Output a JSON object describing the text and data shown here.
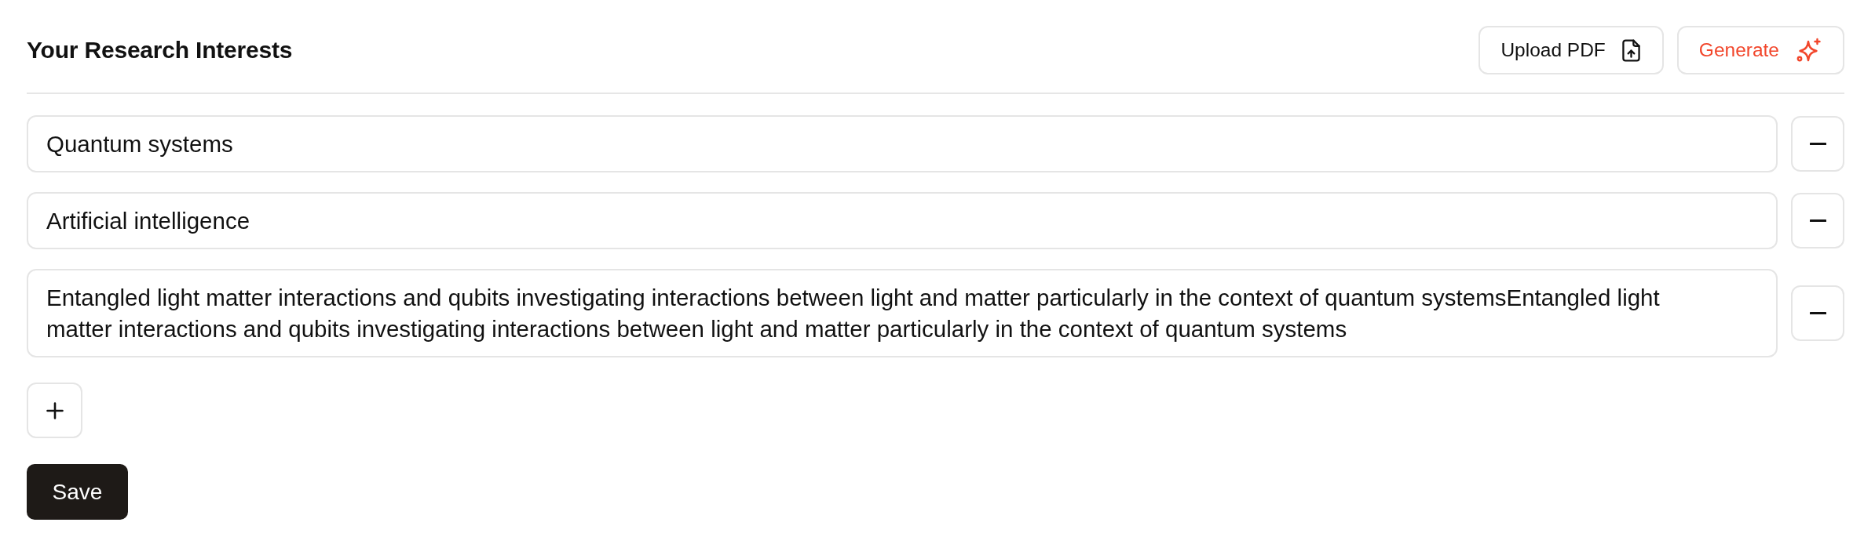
{
  "header": {
    "title": "Your Research Interests",
    "buttons": [
      {
        "label": "Upload PDF",
        "kind": "upload"
      },
      {
        "label": "Generate",
        "kind": "generate"
      }
    ]
  },
  "interests": [
    {
      "value": "Quantum systems"
    },
    {
      "value": "Artificial intelligence"
    },
    {
      "value": "Entangled light matter interactions and qubits investigating interactions between light and matter particularly in the context of quantum systemsEntangled light matter interactions and qubits investigating interactions between light and matter particularly in the context of quantum systems"
    }
  ],
  "actions": {
    "save_label": "Save"
  }
}
